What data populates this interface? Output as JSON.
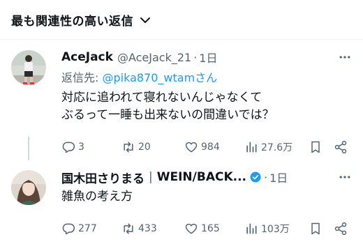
{
  "header": {
    "sort_label": "最も関連性の高い返信",
    "chevron_icon": "chevron-down-icon"
  },
  "tweets": [
    {
      "display_name": "AceJack",
      "handle": "@AceJack_21",
      "time": "1日",
      "reply_prefix": "返信先: ",
      "reply_handle": "@pika870_wtam",
      "reply_suffix": "さん",
      "text": "対応に追われて寝れないんじゃなくて\nぶるって一睡も出来ないの間違いでは？",
      "replies": "3",
      "retweets": "20",
      "likes": "984",
      "views": "27.6万"
    },
    {
      "display_name": "国木田さりまる",
      "separator": "|",
      "display_name_suffix": "WEIN/BACK...",
      "time": "1日",
      "text": "雑魚の考え方",
      "replies": "277",
      "retweets": "433",
      "likes": "165",
      "views": "103万",
      "verified_color": "#1d9bf0"
    }
  ],
  "colors": {
    "text_primary": "#0f1419",
    "text_secondary": "#536471",
    "accent": "#1d9bf0"
  }
}
